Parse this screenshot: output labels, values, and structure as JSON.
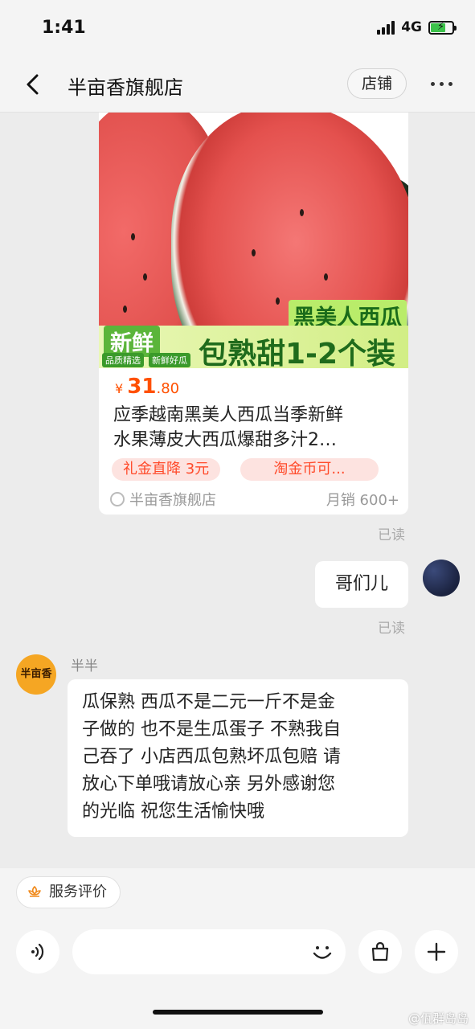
{
  "status_bar": {
    "time": "1:41",
    "network": "4G"
  },
  "header": {
    "title": "半亩香旗舰店",
    "shop_button": "店铺"
  },
  "product": {
    "banner_top": "黑美人西瓜",
    "banner_fresh": "新鲜",
    "banner_tags": [
      "品质精选",
      "新鲜好瓜"
    ],
    "banner_main": "包熟甜1-2个装",
    "price_symbol": "¥",
    "price_int": "31",
    "price_dec": ".80",
    "title_lines": [
      "应季越南黑美人西瓜当季新鲜",
      "水果薄皮大西瓜爆甜多汁2…"
    ],
    "coupons": [
      "礼金直降 3元",
      "淘金币可..."
    ],
    "store": "半亩香旗舰店",
    "sales": "月销 600+"
  },
  "messages": {
    "read_label": "已读",
    "user_message": "哥们儿",
    "shop_avatar_text": "半亩香",
    "sender_name": "半半",
    "shop_message_lines": [
      "瓜保熟 西瓜不是二元一斤不是金",
      "子做的 也不是生瓜蛋子 不熟我自",
      "己吞了 小店西瓜包熟坏瓜包赔 请",
      "放心下单哦请放心亲 另外感谢您",
      "的光临 祝您生活愉快哦"
    ]
  },
  "bottom": {
    "review_chip": "服务评价",
    "input_placeholder": ""
  },
  "watermark": "@佤群岛岛",
  "colors": {
    "price": "#ff5000",
    "coupon_bg": "#fde3e0",
    "shop_avatar": "#f5a623"
  }
}
